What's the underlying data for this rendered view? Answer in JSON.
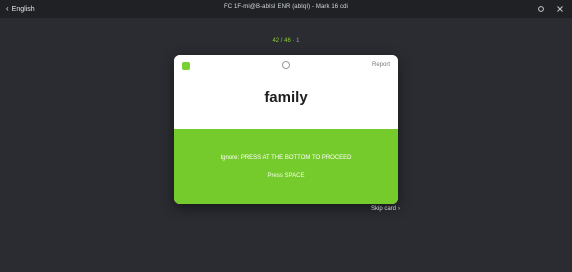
{
  "header": {
    "back_label": "English",
    "title": "FC 1F-mi@B-abIsI ENR (abIqI) - Mark 16 cdi",
    "icons": [
      "settings-icon",
      "close-icon"
    ]
  },
  "progress": {
    "current": "42 / 46",
    "separator": "·",
    "extra": "1"
  },
  "card": {
    "front_word": "family",
    "menu_label": "Report",
    "reveal_text": "Ignore: PRESS AT THE BOTTOM TO PROCEED",
    "press_text": "Press SPACE"
  },
  "skip": {
    "label": "Skip card"
  },
  "colors": {
    "background": "#2a2c31",
    "accent": "#76cb2c",
    "card": "#ffffff"
  }
}
